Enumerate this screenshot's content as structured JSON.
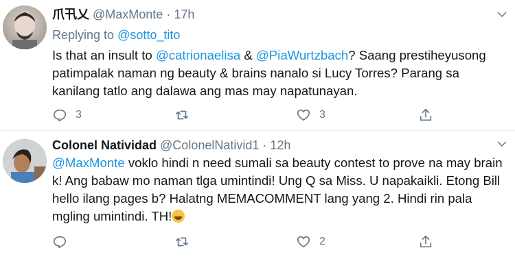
{
  "tweets": [
    {
      "display_name": "爪卂乂",
      "handle": "@MaxMonte",
      "separator": "·",
      "time": "17h",
      "replying_label": "Replying to",
      "replying_to": "@sotto_tito",
      "body": {
        "p1": "Is that an insult to ",
        "m1": "@catrionaelisa",
        "p2": " & ",
        "m2": "@PiaWurtzbach",
        "p3": "? Saang prestiheyusong patimpalak naman ng beauty & brains nanalo si Lucy Torres? Parang sa kanilang tatlo ang dalawa ang mas may napatunayan."
      },
      "actions": {
        "reply_count": "3",
        "retweet_count": "",
        "like_count": "3"
      },
      "icons": {
        "reply": "reply-icon",
        "retweet": "retweet-icon",
        "like": "heart-icon",
        "share": "share-icon",
        "menu": "chevron-down-icon"
      }
    },
    {
      "display_name": "Colonel Natividad",
      "handle": "@ColonelNativid1",
      "separator": "·",
      "time": "12h",
      "body": {
        "m1": "@MaxMonte",
        "p1": " voklo hindi n need sumali sa beauty contest to prove na may brain k! Ang babaw mo naman tlga umintindi! Ung Q sa Miss. U napakaikli. Etong Bill hello ilang pages b? Halatng MEMACOMMENT lang yang 2. Hindi rin pala mgling umintindi. TH!"
      },
      "actions": {
        "reply_count": "",
        "retweet_count": "",
        "like_count": "2"
      },
      "icons": {
        "emoji": "face-with-tears-of-joy-emoji",
        "reply": "reply-icon",
        "retweet": "retweet-icon",
        "like": "heart-icon",
        "share": "share-icon",
        "menu": "chevron-down-icon"
      }
    }
  ],
  "colors": {
    "link": "#1b95e0",
    "muted": "#657786",
    "text": "#14171a",
    "divider": "#e6ecf0"
  }
}
